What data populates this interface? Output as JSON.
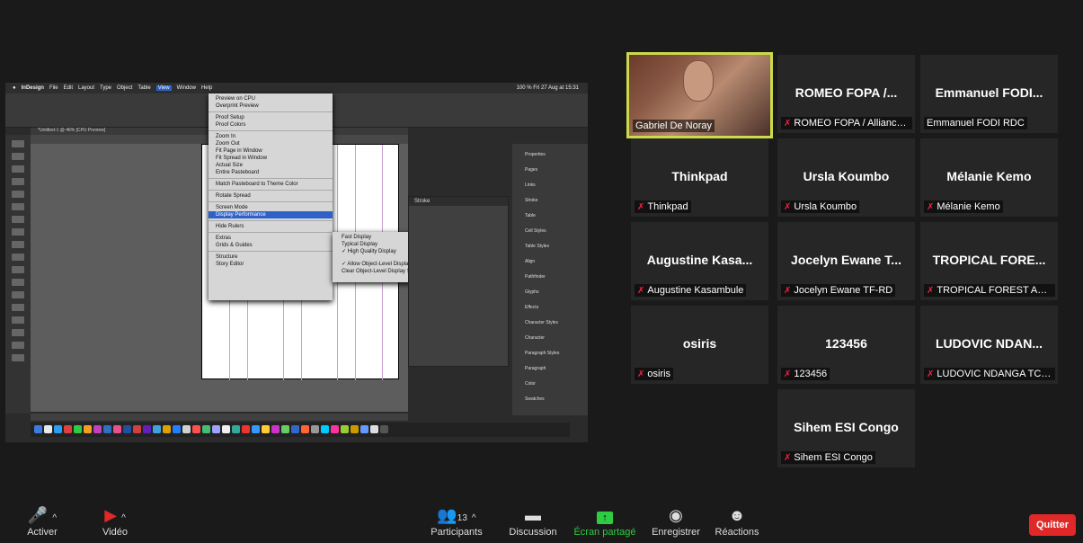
{
  "screenshare": {
    "menubar": [
      "InDesign",
      "File",
      "Edit",
      "Layout",
      "Type",
      "Object",
      "Table",
      "View",
      "Window",
      "Help"
    ],
    "menubar_right": "100 % Fri 27 Aug at 15:31",
    "tab_title": "*Untitled-1 @ 46% [CPU Preview]",
    "view_menu": [
      "Preview on CPU",
      "Overprint Preview",
      "Proof Setup",
      "Proof Colors",
      "Zoom In",
      "Zoom Out",
      "Fit Page in Window",
      "Fit Spread in Window",
      "Actual Size",
      "Entire Pasteboard",
      "Match Pasteboard to Theme Color",
      "Rotate Spread",
      "Screen Mode",
      "Display Performance",
      "Hide Rulers",
      "Extras",
      "Grids & Guides",
      "Structure",
      "Story Editor"
    ],
    "display_submenu": [
      "Fast Display",
      "Typical Display",
      "✓ High Quality Display",
      "✓ Allow Object-Level Display Settings",
      "Clear Object-Level Display Settings"
    ],
    "stroke_panel_title": "Stroke",
    "right_panel": [
      "Properties",
      "Pages",
      "Links",
      "Stroke",
      "Table",
      "Cell Styles",
      "Table Styles",
      "Align",
      "Pathfinder",
      "Glyphs",
      "Effects",
      "Character Styles",
      "Character",
      "Paragraph Styles",
      "Paragraph",
      "Color",
      "Swatches"
    ]
  },
  "participants": [
    {
      "name": "",
      "label": "Gabriel De Noray",
      "muted": false,
      "video": true
    },
    {
      "name": "ROMEO FOPA /...",
      "label": "ROMEO FOPA / Alliance ...",
      "muted": true
    },
    {
      "name": "Emmanuel FODI...",
      "label": "Emmanuel FODI RDC",
      "muted": false
    },
    {
      "name": "Thinkpad",
      "label": "Thinkpad",
      "muted": true
    },
    {
      "name": "Ursla Koumbo",
      "label": "Ursla Koumbo",
      "muted": true
    },
    {
      "name": "Mélanie Kemo",
      "label": "Mélanie Kemo",
      "muted": true
    },
    {
      "name": "Augustine Kasa...",
      "label": "Augustine Kasambule",
      "muted": true
    },
    {
      "name": "Jocelyn Ewane T...",
      "label": "Jocelyn Ewane TF-RD",
      "muted": true
    },
    {
      "name": "TROPICAL FORE...",
      "label": "TROPICAL FOREST AND ...",
      "muted": true
    },
    {
      "name": "osiris",
      "label": "osiris",
      "muted": true
    },
    {
      "name": "123456",
      "label": "123456",
      "muted": true
    },
    {
      "name": "LUDOVIC NDAN...",
      "label": "LUDOVIC NDANGA TCH...",
      "muted": true
    },
    {
      "name": "Sihem ESI Congo",
      "label": "Sihem ESI Congo",
      "muted": true
    }
  ],
  "toolbar": {
    "activer": "Activer",
    "video": "Vidéo",
    "participants": "Participants",
    "participants_count": "13",
    "discussion": "Discussion",
    "ecran": "Écran partagé",
    "enregistrer": "Enregistrer",
    "reactions": "Réactions",
    "quitter": "Quitter"
  },
  "colors": {
    "accent_green": "#2ecc40",
    "quit_red": "#e02828",
    "speaker_border": "#cbd94c"
  }
}
